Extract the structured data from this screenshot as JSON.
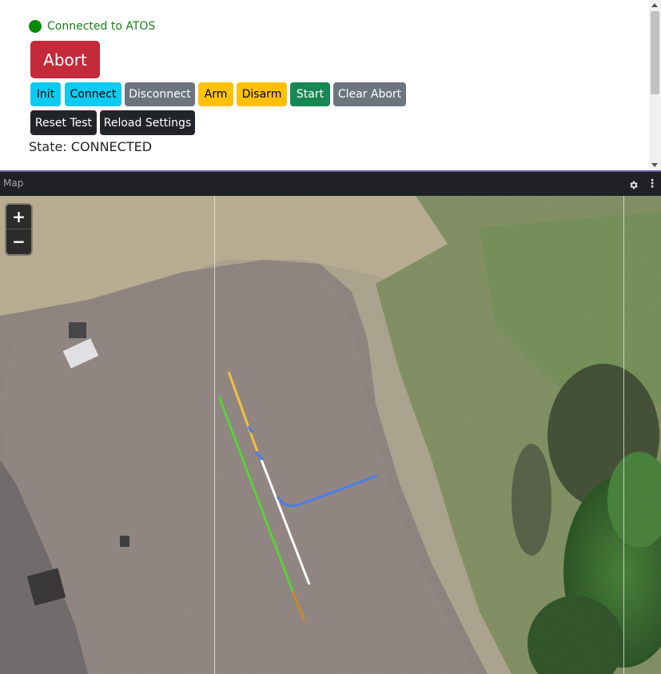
{
  "status": {
    "text": "Connected to ATOS",
    "color": "#0a8a0a"
  },
  "controls": {
    "abort_label": "Abort",
    "row1": [
      {
        "label": "Init",
        "style": "cyan"
      },
      {
        "label": "Connect",
        "style": "cyan"
      },
      {
        "label": "Disconnect",
        "style": "gray"
      },
      {
        "label": "Arm",
        "style": "yellow"
      },
      {
        "label": "Disarm",
        "style": "yellow"
      },
      {
        "label": "Start",
        "style": "green"
      },
      {
        "label": "Clear Abort",
        "style": "gray"
      }
    ],
    "row2": [
      {
        "label": "Reset Test",
        "style": "dark"
      },
      {
        "label": "Reload Settings",
        "style": "dark"
      }
    ]
  },
  "state_text": "State: CONNECTED",
  "map": {
    "title": "Map",
    "zoom_in": "+",
    "zoom_out": "−",
    "icons": {
      "settings": "gear-icon",
      "menu": "kebab-menu-icon"
    },
    "trajectory_colors": {
      "yellow": "#f2c03c",
      "green": "#5ad13a",
      "white": "#ffffff",
      "blue": "#4a7de8",
      "orange": "#c58a2a"
    }
  }
}
